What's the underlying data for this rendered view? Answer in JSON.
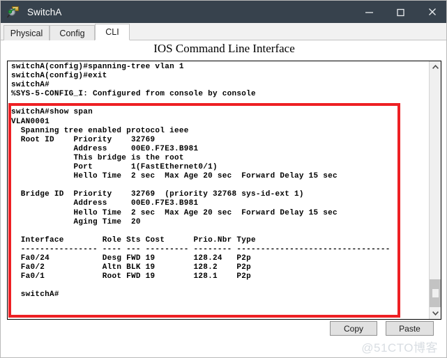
{
  "window": {
    "title": "SwitchA",
    "icon": "switch-magnifier-icon",
    "minimize_label": "—",
    "maximize_label": "□",
    "close_label": "✕",
    "titlebar_color": "#37424d"
  },
  "tabs": [
    {
      "label": "Physical",
      "selected": false
    },
    {
      "label": "Config",
      "selected": false
    },
    {
      "label": "CLI",
      "selected": true
    }
  ],
  "heading": "IOS Command Line Interface",
  "console": {
    "lines": [
      "switchA(config)#spanning-tree vlan 1",
      "switchA(config)#exit",
      "switchA#",
      "%SYS-5-CONFIG_I: Configured from console by console",
      "",
      "switchA#show span",
      "VLAN0001",
      "  Spanning tree enabled protocol ieee",
      "  Root ID    Priority    32769",
      "             Address     00E0.F7E3.B981",
      "             This bridge is the root",
      "             Port        1(FastEthernet0/1)",
      "             Hello Time  2 sec  Max Age 20 sec  Forward Delay 15 sec",
      "",
      "  Bridge ID  Priority    32769  (priority 32768 sys-id-ext 1)",
      "             Address     00E0.F7E3.B981",
      "             Hello Time  2 sec  Max Age 20 sec  Forward Delay 15 sec",
      "             Aging Time  20",
      "",
      "  Interface        Role Sts Cost      Prio.Nbr Type",
      "  ---------------- ---- --- --------- -------- --------------------------------",
      "  Fa0/24           Desg FWD 19        128.24   P2p",
      "  Fa0/2            Altn BLK 19        128.2    P2p",
      "  Fa0/1            Root FWD 19        128.1    P2p",
      "",
      "  switchA#"
    ],
    "text": "switchA(config)#spanning-tree vlan 1\nswitchA(config)#exit\nswitchA#\n%SYS-5-CONFIG_I: Configured from console by console\n\nswitchA#show span\nVLAN0001\n  Spanning tree enabled protocol ieee\n  Root ID    Priority    32769\n             Address     00E0.F7E3.B981\n             This bridge is the root\n             Port        1(FastEthernet0/1)\n             Hello Time  2 sec  Max Age 20 sec  Forward Delay 15 sec\n\n  Bridge ID  Priority    32769  (priority 32768 sys-id-ext 1)\n             Address     00E0.F7E3.B981\n             Hello Time  2 sec  Max Age 20 sec  Forward Delay 15 sec\n             Aging Time  20\n\n  Interface        Role Sts Cost      Prio.Nbr Type\n  ---------------- ---- --- --------- -------- --------------------------------\n  Fa0/24           Desg FWD 19        128.24   P2p\n  Fa0/2            Altn BLK 19        128.2    P2p\n  Fa0/1            Root FWD 19        128.1    P2p\n\n  switchA#",
    "spanning_tree": {
      "vlan": "VLAN0001",
      "protocol": "ieee",
      "root_id": {
        "priority": "32769",
        "address": "00E0.F7E3.B981",
        "note": "This bridge is the root",
        "port": "1(FastEthernet0/1)",
        "hello_time": "2 sec",
        "max_age": "20 sec",
        "forward_delay": "15 sec"
      },
      "bridge_id": {
        "priority": "32769",
        "priority_detail": "(priority 32768 sys-id-ext 1)",
        "address": "00E0.F7E3.B981",
        "hello_time": "2 sec",
        "max_age": "20 sec",
        "forward_delay": "15 sec",
        "aging_time": "20"
      },
      "table_headers": [
        "Interface",
        "Role",
        "Sts",
        "Cost",
        "Prio.Nbr",
        "Type"
      ],
      "table_rows": [
        [
          "Fa0/24",
          "Desg",
          "FWD",
          "19",
          "128.24",
          "P2p"
        ],
        [
          "Fa0/2",
          "Altn",
          "BLK",
          "19",
          "128.2",
          "P2p"
        ],
        [
          "Fa0/1",
          "Root",
          "FWD",
          "19",
          "128.1",
          "P2p"
        ]
      ],
      "prompt": "switchA#"
    }
  },
  "scrollbar": {
    "up_arrow": "▲",
    "down_arrow": "▼"
  },
  "annotation": {
    "color": "#ee2024",
    "name": "red-highlight-box"
  },
  "buttons": {
    "copy_label": "Copy",
    "paste_label": "Paste"
  },
  "watermark": "@51CTO博客"
}
